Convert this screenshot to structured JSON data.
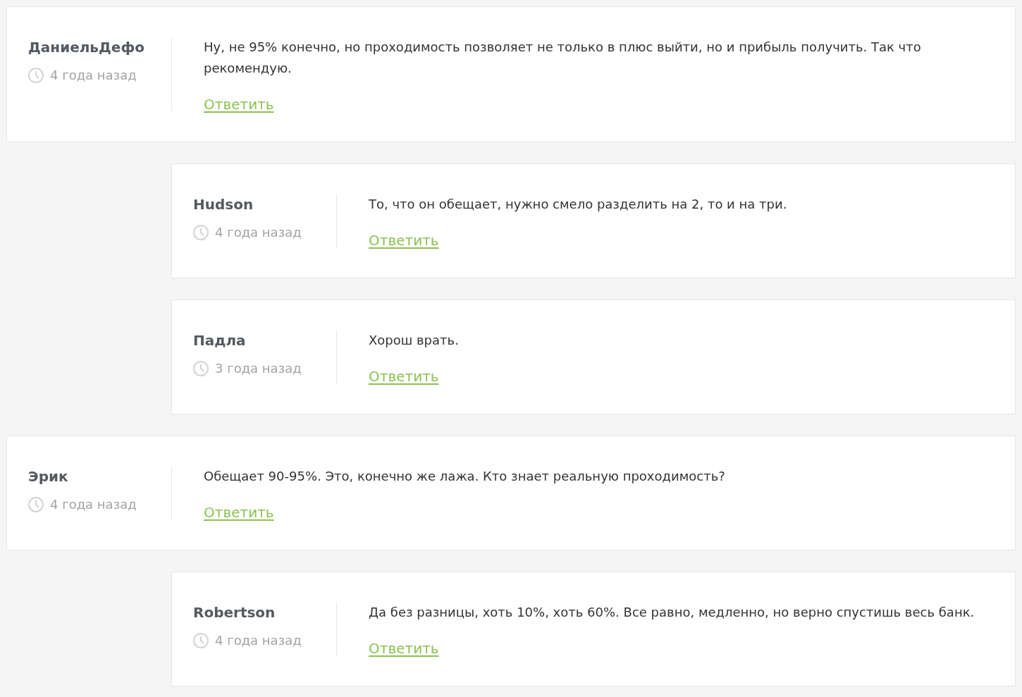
{
  "comments": [
    {
      "author": "ДаниельДефо",
      "time": "4 года назад",
      "text": "Ну, не 95% конечно, но проходимость позволяет не только в плюс выйти, но и прибыль получить. Так что рекомендую.",
      "reply_link": "Ответить",
      "children": [
        {
          "author": "Hudson",
          "time": "4 года назад",
          "text": "То, что он обещает, нужно смело разделить на 2, то и на три.",
          "reply_link": "Ответить"
        },
        {
          "author": "Падла",
          "time": "3 года назад",
          "text": "Хорош врать.",
          "reply_link": "Ответить"
        }
      ]
    },
    {
      "author": "Эрик",
      "time": "4 года назад",
      "text": "Обещает 90-95%. Это, конечно же лажа. Кто знает реальную проходимость?",
      "reply_link": "Ответить",
      "children": [
        {
          "author": "Robertson",
          "time": "4 года назад",
          "text": "Да без разницы, хоть 10%, хоть 60%. Все равно, медленно, но верно спустишь весь банк.",
          "reply_link": "Ответить"
        }
      ]
    }
  ]
}
